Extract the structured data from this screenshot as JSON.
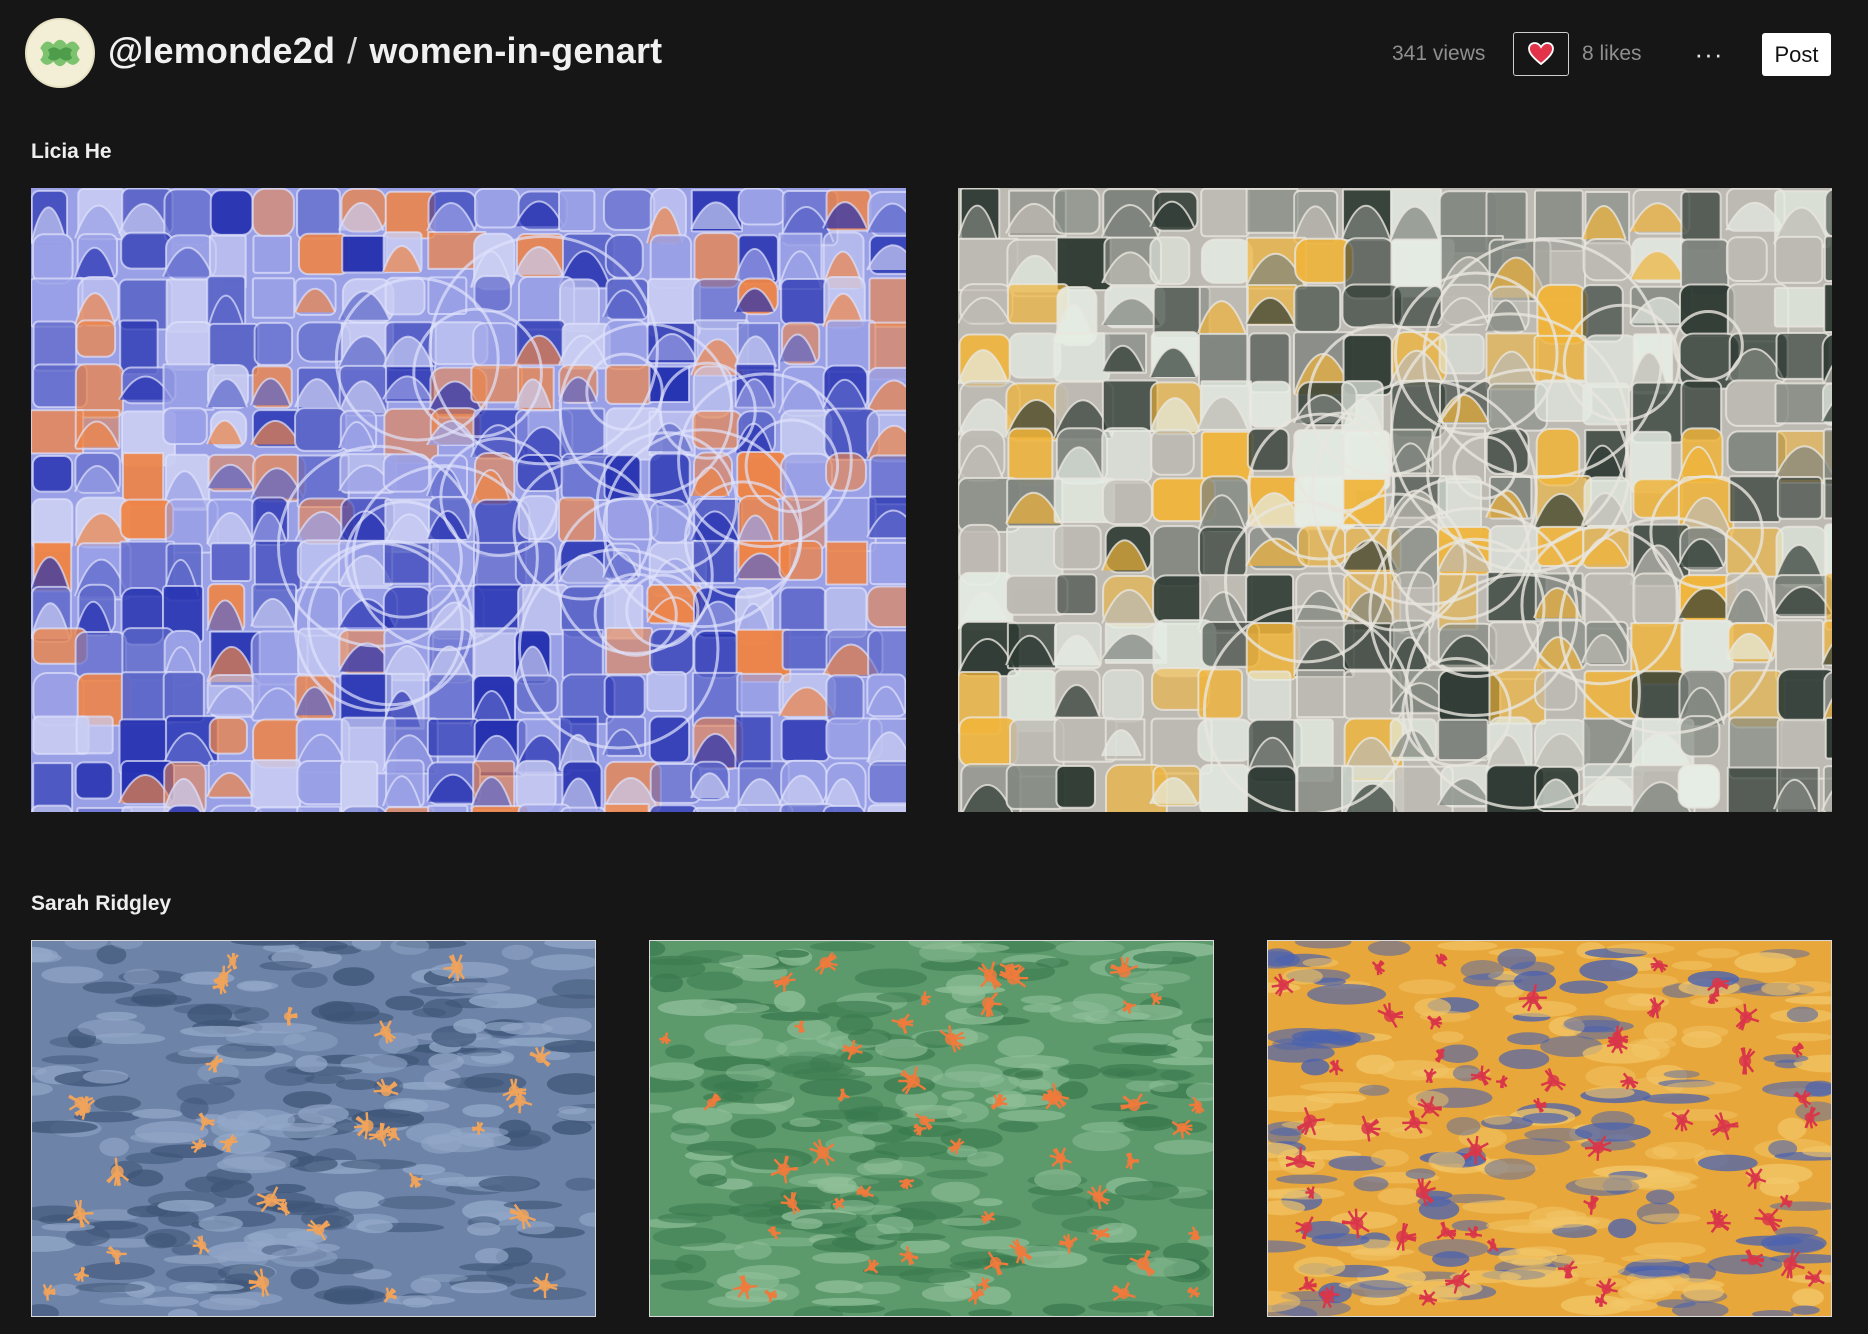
{
  "header": {
    "username": "@lemonde2d",
    "separator": "/",
    "collection": "women-in-genart",
    "views": "341 views",
    "likes": "8 likes",
    "more_label": "···",
    "post_label": "Post"
  },
  "icons": {
    "avatar": "avatar-logo",
    "like": "heart-icon",
    "more": "more-icon"
  },
  "colors": {
    "background": "#161616",
    "heart": "#e2334a",
    "text_muted": "#8f8f8f"
  },
  "sections": [
    {
      "artist": "Licia He",
      "artworks": [
        {
          "palette": [
            "#9aa0e6",
            "#2531b0",
            "#ee8446",
            "#c9cdf2",
            "#5d67c9"
          ]
        },
        {
          "palette": [
            "#bdbab3",
            "#2e3a33",
            "#f0b43a",
            "#e5ede4",
            "#7f857e"
          ]
        }
      ]
    },
    {
      "artist": "Sarah Ridgley",
      "artworks": [
        {
          "palette": [
            "#6d83a8",
            "#3e5577",
            "#94a9c9",
            "#f0a35a",
            "#9aa06a"
          ]
        },
        {
          "palette": [
            "#5c9a6c",
            "#3a7a4e",
            "#8fbf98",
            "#f07a3c",
            "#a9d0a8"
          ]
        },
        {
          "palette": [
            "#e8a73a",
            "#4a62b0",
            "#f2c668",
            "#d9364a",
            "#b8862c"
          ]
        }
      ]
    }
  ]
}
